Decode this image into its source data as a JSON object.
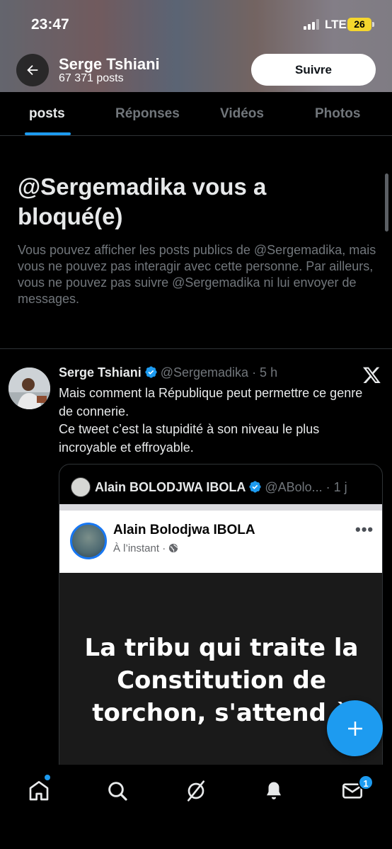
{
  "status_bar": {
    "time": "23:47",
    "network": "LTE",
    "battery": "26"
  },
  "header": {
    "name": "Serge Tshiani",
    "posts_count": "67 371 posts",
    "follow_label": "Suivre"
  },
  "tabs": [
    {
      "label": "posts",
      "active": true
    },
    {
      "label": "Réponses",
      "active": false
    },
    {
      "label": "Vidéos",
      "active": false
    },
    {
      "label": "Photos",
      "active": false
    }
  ],
  "blocked": {
    "title": "@Sergemadika vous a bloqué(e)",
    "text": "Vous pouvez afficher les posts publics de @Sergemadika, mais vous ne pouvez pas interagir avec cette personne. Par ailleurs, vous ne pouvez pas suivre @Sergemadika ni lui envoyer de messages."
  },
  "tweet": {
    "name": "Serge Tshiani",
    "handle": "@Sergemadika",
    "time": "· 5 h",
    "line1": "Mais comment la République peut permettre ce genre de connerie.",
    "line2": "Ce tweet c’est la stupidité à son niveau le plus incroyable et effroyable.",
    "quote": {
      "name": "Alain BOLODJWA IBOLA",
      "handle": "@ABolo...",
      "time": "· 1 j",
      "fb_name": "Alain Bolodjwa IBOLA",
      "fb_meta": "À l’instant ·",
      "fb_menu": "•••",
      "image_text_1": "La tribu qui traite la",
      "image_text_2": "Constitution de",
      "image_text_3": "torchon, s'attend à"
    }
  },
  "nav": {
    "notifications_badge": "1"
  },
  "colors": {
    "accent": "#1d9bf0",
    "background": "#000000",
    "muted": "#71767b"
  }
}
